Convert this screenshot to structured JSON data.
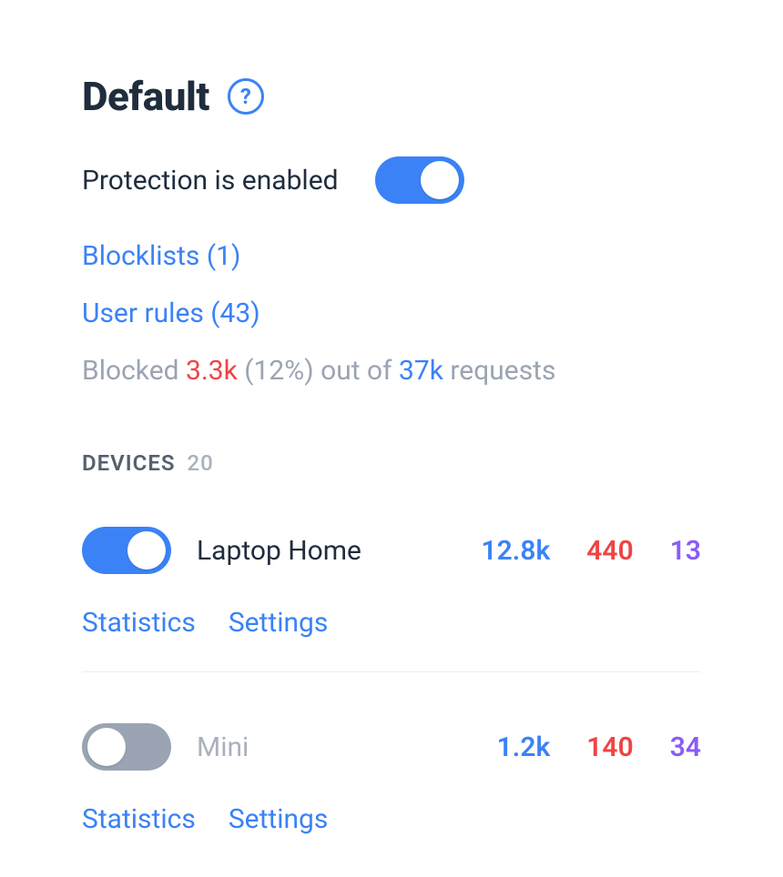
{
  "title": "Default",
  "status": {
    "text": "Protection is enabled",
    "enabled": true
  },
  "links": {
    "blocklists": {
      "label": "Blocklists",
      "count": 1,
      "display": "Blocklists (1)"
    },
    "user_rules": {
      "label": "User rules",
      "count": 43,
      "display": "User rules (43)"
    }
  },
  "summary": {
    "prefix": "Blocked ",
    "blocked": "3.3k",
    "percent": " (12%) ",
    "mid": "out of ",
    "total": "37k",
    "suffix": " requests"
  },
  "devices_header": {
    "label": "DEVICES",
    "count": "20"
  },
  "devices": [
    {
      "name": "Laptop Home",
      "enabled": true,
      "stats": {
        "requests": "12.8k",
        "blocked": "440",
        "other": "13"
      },
      "links": {
        "statistics": "Statistics",
        "settings": "Settings"
      }
    },
    {
      "name": "Mini",
      "enabled": false,
      "stats": {
        "requests": "1.2k",
        "blocked": "140",
        "other": "34"
      },
      "links": {
        "statistics": "Statistics",
        "settings": "Settings"
      }
    }
  ]
}
